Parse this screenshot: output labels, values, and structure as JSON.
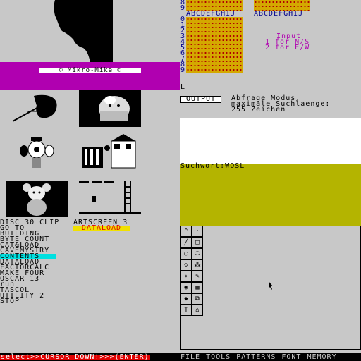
{
  "banner": {
    "copyright": "© Mikro-Mike ©"
  },
  "thumbs": {
    "clip_title": "DISC 30 CLIP",
    "art_title": "ARTSCREEN 3",
    "selected_file": "DATALOAD"
  },
  "file_list": [
    "GO TO",
    "BUILDING",
    "BYTE COUNT",
    "CAT&LOAD",
    "CAVEMYSTRY",
    "CONTENTS",
    "DATALOAD",
    "FACTORCALC",
    "MAKE FOUR",
    "OSCAR 13",
    "run",
    "TASCOL",
    "UTILITY 2",
    "STOP"
  ],
  "highlighted_index": 5,
  "grids": {
    "col_header_1": "ABCDEFGHIJ",
    "col_header_2": "ABCDEFGHIJ",
    "row_labels": [
      "0",
      "1",
      "2",
      "3",
      "4",
      "5",
      "6",
      "7",
      "8",
      "9"
    ],
    "top_rows": [
      "8",
      "9"
    ]
  },
  "input_prompt": {
    "line1": "Input",
    "line2": "1 for N/S",
    "line3": "2 for E/W"
  },
  "marker": "L",
  "output_panel": {
    "button": "OUTPUT",
    "line1": "Abfrage Modus.",
    "line2": "maximale Suchlaenge:",
    "line3": "255 Zeichen"
  },
  "search": {
    "label": "Suchwort:WOSL"
  },
  "tools": [
    [
      "line-tool-icon",
      "dot-tool-icon"
    ],
    [
      "diagonal-tool-icon",
      "rectangle-tool-icon"
    ],
    [
      "circle-tool-icon",
      "ellipse-tool-icon"
    ],
    [
      "diamond-tool-icon",
      "spray-tool-icon"
    ],
    [
      "brush-tool-icon",
      "pen-tool-icon"
    ],
    [
      "fill-tool-icon",
      "pattern-tool-icon"
    ],
    [
      "eraser-tool-icon",
      "copy-tool-icon"
    ],
    [
      "text-tool-icon",
      "home-tool-icon"
    ]
  ],
  "status_bar": {
    "text": "select>>CURSOR DOWN!>>>(ENTER)"
  },
  "menu_bar": [
    "FILE",
    "TOOLS",
    "PATTERNS",
    "FONT",
    "MEMORY"
  ],
  "colors": {
    "magenta": "#b000b0",
    "olive": "#b4b400",
    "cyan": "#00e0e0",
    "red": "#e00000",
    "yellow": "#f0e000"
  }
}
